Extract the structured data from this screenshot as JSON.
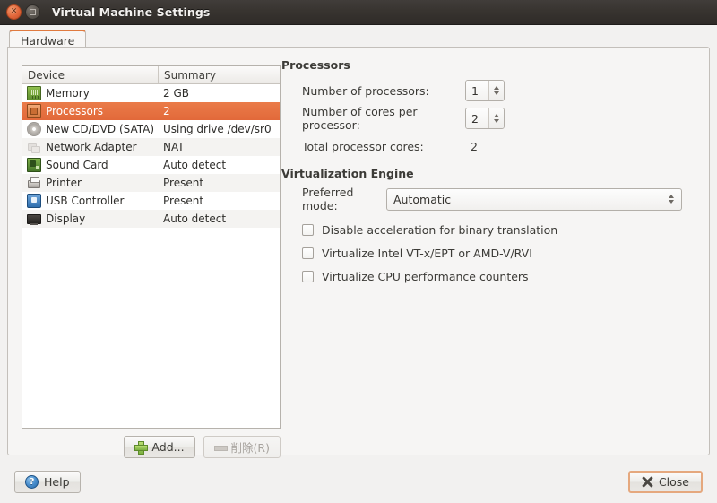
{
  "window": {
    "title": "Virtual Machine Settings",
    "close_icon": "window-close-icon",
    "maximize_icon": "window-maximize-icon"
  },
  "tabs": [
    {
      "label": "Hardware",
      "active": true
    }
  ],
  "device_list": {
    "columns": [
      "Device",
      "Summary"
    ],
    "rows": [
      {
        "icon": "memory-icon",
        "device": "Memory",
        "summary": "2 GB",
        "selected": false
      },
      {
        "icon": "processor-icon",
        "device": "Processors",
        "summary": "2",
        "selected": true
      },
      {
        "icon": "cd-dvd-icon",
        "device": "New CD/DVD (SATA)",
        "summary": "Using drive /dev/sr0",
        "selected": false
      },
      {
        "icon": "network-adapter-icon",
        "device": "Network Adapter",
        "summary": "NAT",
        "selected": false
      },
      {
        "icon": "sound-card-icon",
        "device": "Sound Card",
        "summary": "Auto detect",
        "selected": false
      },
      {
        "icon": "printer-icon",
        "device": "Printer",
        "summary": "Present",
        "selected": false
      },
      {
        "icon": "usb-controller-icon",
        "device": "USB Controller",
        "summary": "Present",
        "selected": false
      },
      {
        "icon": "display-icon",
        "device": "Display",
        "summary": "Auto detect",
        "selected": false
      }
    ],
    "add_button": "Add...",
    "remove_button": "削除(R)"
  },
  "processors": {
    "group_title": "Processors",
    "num_processors_label": "Number of processors:",
    "num_processors_value": "1",
    "cores_per_processor_label": "Number of cores per processor:",
    "cores_per_processor_value": "2",
    "total_cores_label": "Total processor cores:",
    "total_cores_value": "2"
  },
  "virtualization": {
    "group_title": "Virtualization Engine",
    "preferred_mode_label": "Preferred mode:",
    "preferred_mode_value": "Automatic",
    "checkboxes": [
      {
        "label": "Disable acceleration for binary translation",
        "checked": false
      },
      {
        "label": "Virtualize Intel VT-x/EPT or AMD-V/RVI",
        "checked": false
      },
      {
        "label": "Virtualize CPU performance counters",
        "checked": false
      }
    ]
  },
  "footer": {
    "help_label": "Help",
    "close_label": "Close",
    "help_icon": "question-mark-icon",
    "close_icon": "x-mark-icon"
  },
  "colors": {
    "accent": "#e2693a",
    "titlebar": "#37332f",
    "panel_bg": "#f6f5f4"
  }
}
